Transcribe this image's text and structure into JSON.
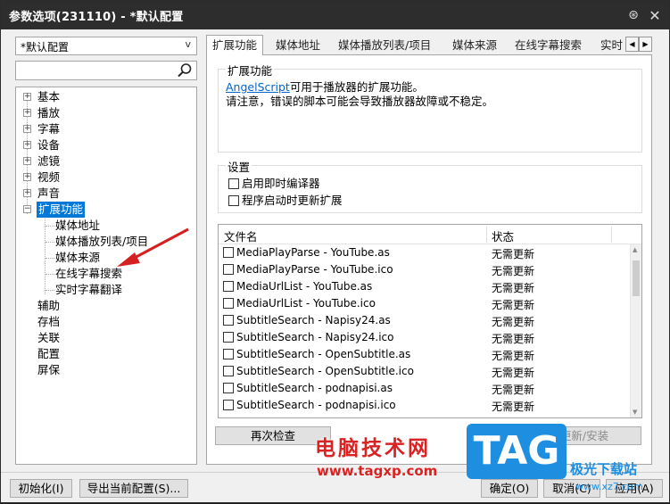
{
  "window": {
    "title": "参数选项(231110) - *默认配置",
    "pin_icon": "pin-icon",
    "close_icon": "close-icon"
  },
  "profile_combo": {
    "value": "*默认配置"
  },
  "search": {
    "placeholder": ""
  },
  "tree": {
    "items": [
      {
        "label": "基本",
        "expandable": true
      },
      {
        "label": "播放",
        "expandable": true
      },
      {
        "label": "字幕",
        "expandable": true
      },
      {
        "label": "设备",
        "expandable": true
      },
      {
        "label": "滤镜",
        "expandable": true
      },
      {
        "label": "视频",
        "expandable": true
      },
      {
        "label": "声音",
        "expandable": true
      },
      {
        "label": "扩展功能",
        "expandable": true,
        "expanded": true,
        "selected": true
      },
      {
        "label": "媒体地址",
        "child": true
      },
      {
        "label": "媒体播放列表/项目",
        "child": true
      },
      {
        "label": "媒体来源",
        "child": true
      },
      {
        "label": "在线字幕搜索",
        "child": true
      },
      {
        "label": "实时字幕翻译",
        "child": true
      },
      {
        "label": "辅助"
      },
      {
        "label": "存档"
      },
      {
        "label": "关联"
      },
      {
        "label": "配置"
      },
      {
        "label": "屏保"
      }
    ]
  },
  "tabs": [
    {
      "label": "扩展功能",
      "active": true
    },
    {
      "label": "媒体地址"
    },
    {
      "label": "媒体播放列表/项目"
    },
    {
      "label": "媒体来源"
    },
    {
      "label": "在线字幕搜索"
    },
    {
      "label": "实时"
    }
  ],
  "extensions_group": {
    "title": "扩展功能",
    "link": "AngelScript",
    "line1_suffix": "可用于播放器的扩展功能。",
    "line2": "请注意，错误的脚本可能会导致播放器故障或不稳定。"
  },
  "settings_group": {
    "title": "设置",
    "options": [
      {
        "label": "启用即时编译器",
        "checked": false
      },
      {
        "label": "程序启动时更新扩展",
        "checked": false
      }
    ]
  },
  "file_list": {
    "columns": [
      "文件名",
      "状态"
    ],
    "rows": [
      {
        "name": "MediaPlayParse - YouTube.as",
        "status": "无需更新"
      },
      {
        "name": "MediaPlayParse - YouTube.ico",
        "status": "无需更新"
      },
      {
        "name": "MediaUrlList - YouTube.as",
        "status": "无需更新"
      },
      {
        "name": "MediaUrlList - YouTube.ico",
        "status": "无需更新"
      },
      {
        "name": "SubtitleSearch - Napisy24.as",
        "status": "无需更新"
      },
      {
        "name": "SubtitleSearch - Napisy24.ico",
        "status": "无需更新"
      },
      {
        "name": "SubtitleSearch - OpenSubtitle.as",
        "status": "无需更新"
      },
      {
        "name": "SubtitleSearch - OpenSubtitle.ico",
        "status": "无需更新"
      },
      {
        "name": "SubtitleSearch - podnapisi.as",
        "status": "无需更新"
      },
      {
        "name": "SubtitleSearch - podnapisi.ico",
        "status": "无需更新"
      }
    ]
  },
  "buttons": {
    "recheck": "再次检查",
    "update_install": "更新/安装",
    "init": "初始化(I)",
    "export": "导出当前配置(S)...",
    "ok": "确定(O)",
    "cancel": "取消(C)",
    "apply": "应用(A)"
  },
  "watermark": {
    "cn_name": "电脑技术网",
    "url": "www.tagxp.com",
    "badge": "TAG",
    "cn_name2": "极光下载站",
    "url2": "www.xz7.com"
  },
  "colors": {
    "title_bg": "#2d2d2d",
    "selection": "#0078d7",
    "link": "#0066cc",
    "annotation_arrow": "#d42020"
  }
}
